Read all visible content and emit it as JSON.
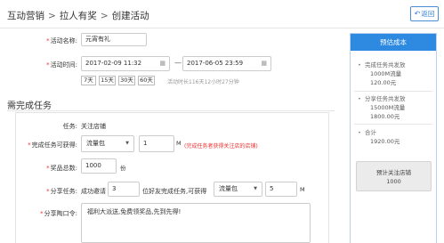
{
  "breadcrumb": {
    "items": [
      "互动营销",
      "拉人有奖",
      "创建活动"
    ],
    "sep": ">"
  },
  "back_button": {
    "icon": "back-arrow-icon",
    "glyph": "↶",
    "label": "返回"
  },
  "form": {
    "name": {
      "label": "活动名称:",
      "value": "元宵有礼"
    },
    "time": {
      "label": "活动时间:",
      "start": "2017-02-09 11:32",
      "end": "2017-06-05 23:59",
      "separator": "—",
      "calendar_icon": "calendar-icon",
      "calendar_glyph": "▦",
      "quick_ranges": [
        "7天",
        "15天",
        "30天",
        "60天"
      ],
      "duration_hint": "活动时长116天12小时27分钟"
    }
  },
  "task_section": {
    "title": "需完成任务",
    "task": {
      "label": "任务:",
      "value": "关注店铺"
    },
    "reward": {
      "label": "完成任务可获得:",
      "type": "流量包",
      "caret": "▼",
      "amount": "1",
      "unit": "M",
      "note": "(完成任务者获得关注店的店铺)"
    },
    "total": {
      "label": "奖品总数:",
      "value": "1000",
      "unit": "份"
    },
    "share": {
      "label": "分享任务:",
      "prefix": "成功邀请",
      "count": "3",
      "middle": "位好友完成任务,可获得",
      "type": "流量包",
      "caret": "▼",
      "amount": "5",
      "unit": "M"
    },
    "slogan": {
      "label": "分享陶口令:",
      "value": "福利大派送,免费领奖品,先到先得!"
    }
  },
  "side_panel": {
    "header": "预估成本",
    "bullet": "•",
    "items": [
      {
        "line1": "完成任务共发放",
        "line2": "1000M流量",
        "line3": "120.00元"
      },
      {
        "line1": "分享任务共发放",
        "line2": "15000M流量",
        "line3": "1800.00元"
      },
      {
        "line1": "合计",
        "line2": "1920.00元"
      }
    ],
    "button": {
      "line1": "预计关注店铺",
      "line2": "1000"
    }
  }
}
